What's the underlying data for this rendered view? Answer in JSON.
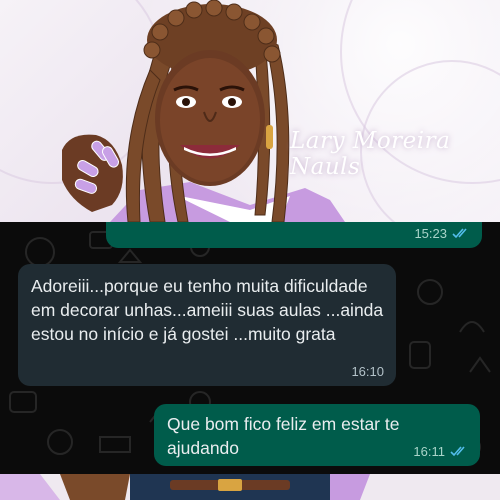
{
  "banner": {
    "signature": "Lary Moreira Nauls"
  },
  "chat": {
    "messages": [
      {
        "direction": "out",
        "text": "",
        "time": "15:23",
        "status": "read-double-check-icon"
      },
      {
        "direction": "in",
        "text": "Adoreiii...porque eu tenho muita dificuldade em decorar unhas...ameiii suas aulas ...ainda estou no início e já gostei ...muito grata",
        "time": "16:10"
      },
      {
        "direction": "out",
        "text": "Que bom fico feliz em estar te ajudando",
        "time": "16:11",
        "status": "read-double-check-icon"
      }
    ]
  },
  "colors": {
    "outgoing_bubble": "#005c4b",
    "incoming_bubble": "#202c33",
    "chat_background": "#0b0b0b",
    "read_ticks": "#53bdeb",
    "jacket": "#c79be0"
  }
}
